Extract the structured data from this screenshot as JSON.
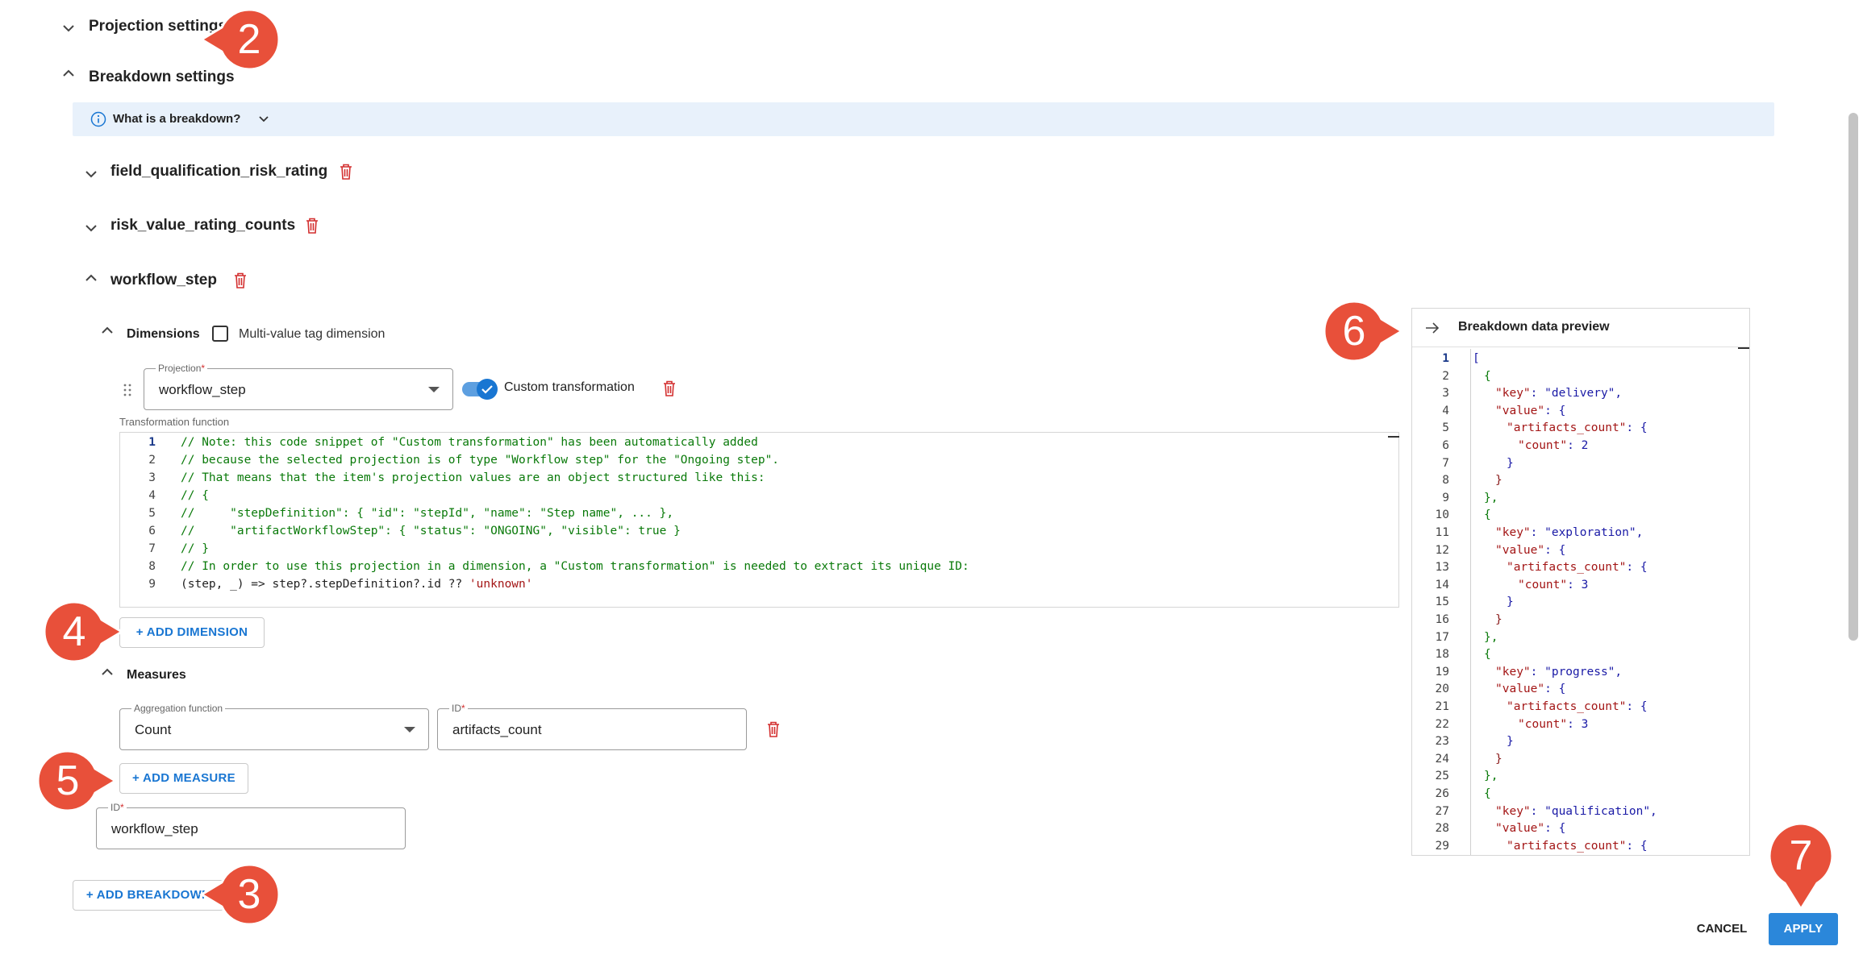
{
  "projection_settings": {
    "title": "Projection settings"
  },
  "breakdown_settings": {
    "title": "Breakdown settings"
  },
  "info": {
    "label": "What is a breakdown?"
  },
  "breakdowns": [
    {
      "name": "field_qualification_risk_rating"
    },
    {
      "name": "risk_value_rating_counts"
    },
    {
      "name": "workflow_step"
    }
  ],
  "dimensions": {
    "title": "Dimensions",
    "multi_value_label": "Multi-value tag dimension",
    "multi_value_checked": false,
    "projection_label": "Projection",
    "projection_value": "workflow_step",
    "custom_transformation_label": "Custom transformation",
    "custom_transformation_on": true,
    "transformation_function_label": "Transformation function",
    "add_dimension_label": "+ ADD DIMENSION"
  },
  "code": [
    {
      "n": "1",
      "text": "// Note: this code snippet of \"Custom transformation\" has been automatically added"
    },
    {
      "n": "2",
      "text": "// because the selected projection is of type \"Workflow step\" for the \"Ongoing step\"."
    },
    {
      "n": "3",
      "text": "// That means that the item's projection values are an object structured like this:"
    },
    {
      "n": "4",
      "text": "// {"
    },
    {
      "n": "5",
      "text": "//     \"stepDefinition\": { \"id\": \"stepId\", \"name\": \"Step name\", ... },"
    },
    {
      "n": "6",
      "text": "//     \"artifactWorkflowStep\": { \"status\": \"ONGOING\", \"visible\": true }"
    },
    {
      "n": "7",
      "text": "// }"
    },
    {
      "n": "8",
      "text": "// In order to use this projection in a dimension, a \"Custom transformation\" is needed to extract its unique ID:"
    },
    {
      "n": "9",
      "text_a": "(step, _) => step?.stepDefinition?.id ?? ",
      "text_b": "'unknown'"
    }
  ],
  "measures": {
    "title": "Measures",
    "aggregation_label": "Aggregation function",
    "aggregation_value": "Count",
    "id_label": "ID",
    "id_value": "artifacts_count",
    "add_measure_label": "+ ADD MEASURE"
  },
  "breakdown_id": {
    "label": "ID",
    "value": "workflow_step"
  },
  "add_breakdown_label": "+ ADD BREAKDOWN",
  "preview": {
    "title": "Breakdown data preview",
    "lines": [
      "[",
      "{",
      "\"key\": \"delivery\",",
      "\"value\": {",
      "\"artifacts_count\": {",
      "\"count\": 2",
      "}",
      "}",
      "},",
      "{",
      "\"key\": \"exploration\",",
      "\"value\": {",
      "\"artifacts_count\": {",
      "\"count\": 3",
      "}",
      "}",
      "},",
      "{",
      "\"key\": \"progress\",",
      "\"value\": {",
      "\"artifacts_count\": {",
      "\"count\": 3",
      "}",
      "}",
      "},",
      "{",
      "\"key\": \"qualification\",",
      "\"value\": {",
      "\"artifacts_count\": {"
    ]
  },
  "actions": {
    "cancel": "CANCEL",
    "apply": "APPLY"
  },
  "callouts": [
    "2",
    "3",
    "4",
    "5",
    "6",
    "7"
  ],
  "colors": {
    "accent": "#1976d2",
    "callout": "#e8503a",
    "delete": "#d32f2f",
    "info_bg": "#e8f1fb"
  }
}
